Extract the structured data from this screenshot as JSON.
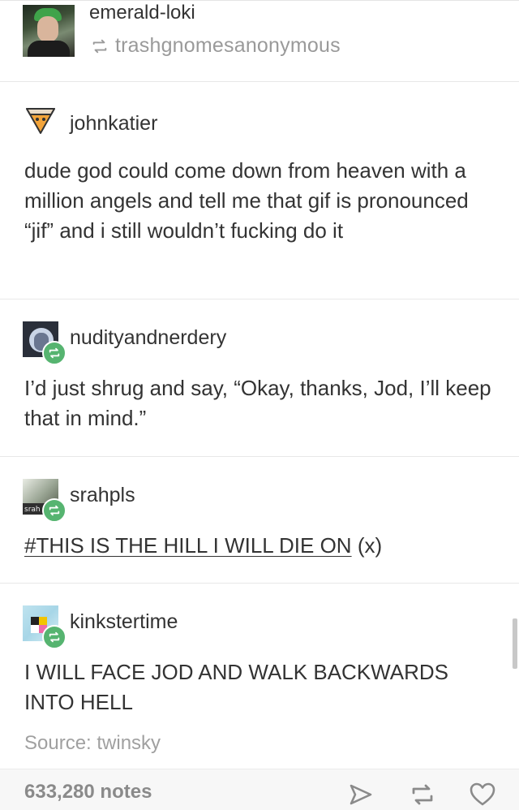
{
  "header": {
    "blog_name": "emerald-loki",
    "reblogged_from": "trashgnomesanonymous"
  },
  "posts": [
    {
      "username": "johnkatier",
      "text": "dude god could come down from heaven with a million angels and tell me that gif is pronounced “jif” and i still wouldn’t fucking do it"
    },
    {
      "username": "nudityandnerdery",
      "text": "I’d just shrug and say, “Okay, thanks, Jod, I’ll keep that in mind.”"
    },
    {
      "username": "srahpls",
      "avatar_label": "srah",
      "tag": "#THIS IS THE HILL I WILL DIE ON",
      "link": "(x)"
    },
    {
      "username": "kinkstertime",
      "text": "I WILL FACE JOD AND WALK BACKWARDS INTO HELL"
    }
  ],
  "source": "Source: twinsky",
  "footer": {
    "notes": "633,280 notes"
  },
  "icons": {
    "reblog": "reblog-icon",
    "share": "share-icon",
    "like": "heart-icon"
  },
  "colors": {
    "badge_green": "#56b470",
    "text_primary": "#333333",
    "text_muted": "#9a9a9a"
  }
}
